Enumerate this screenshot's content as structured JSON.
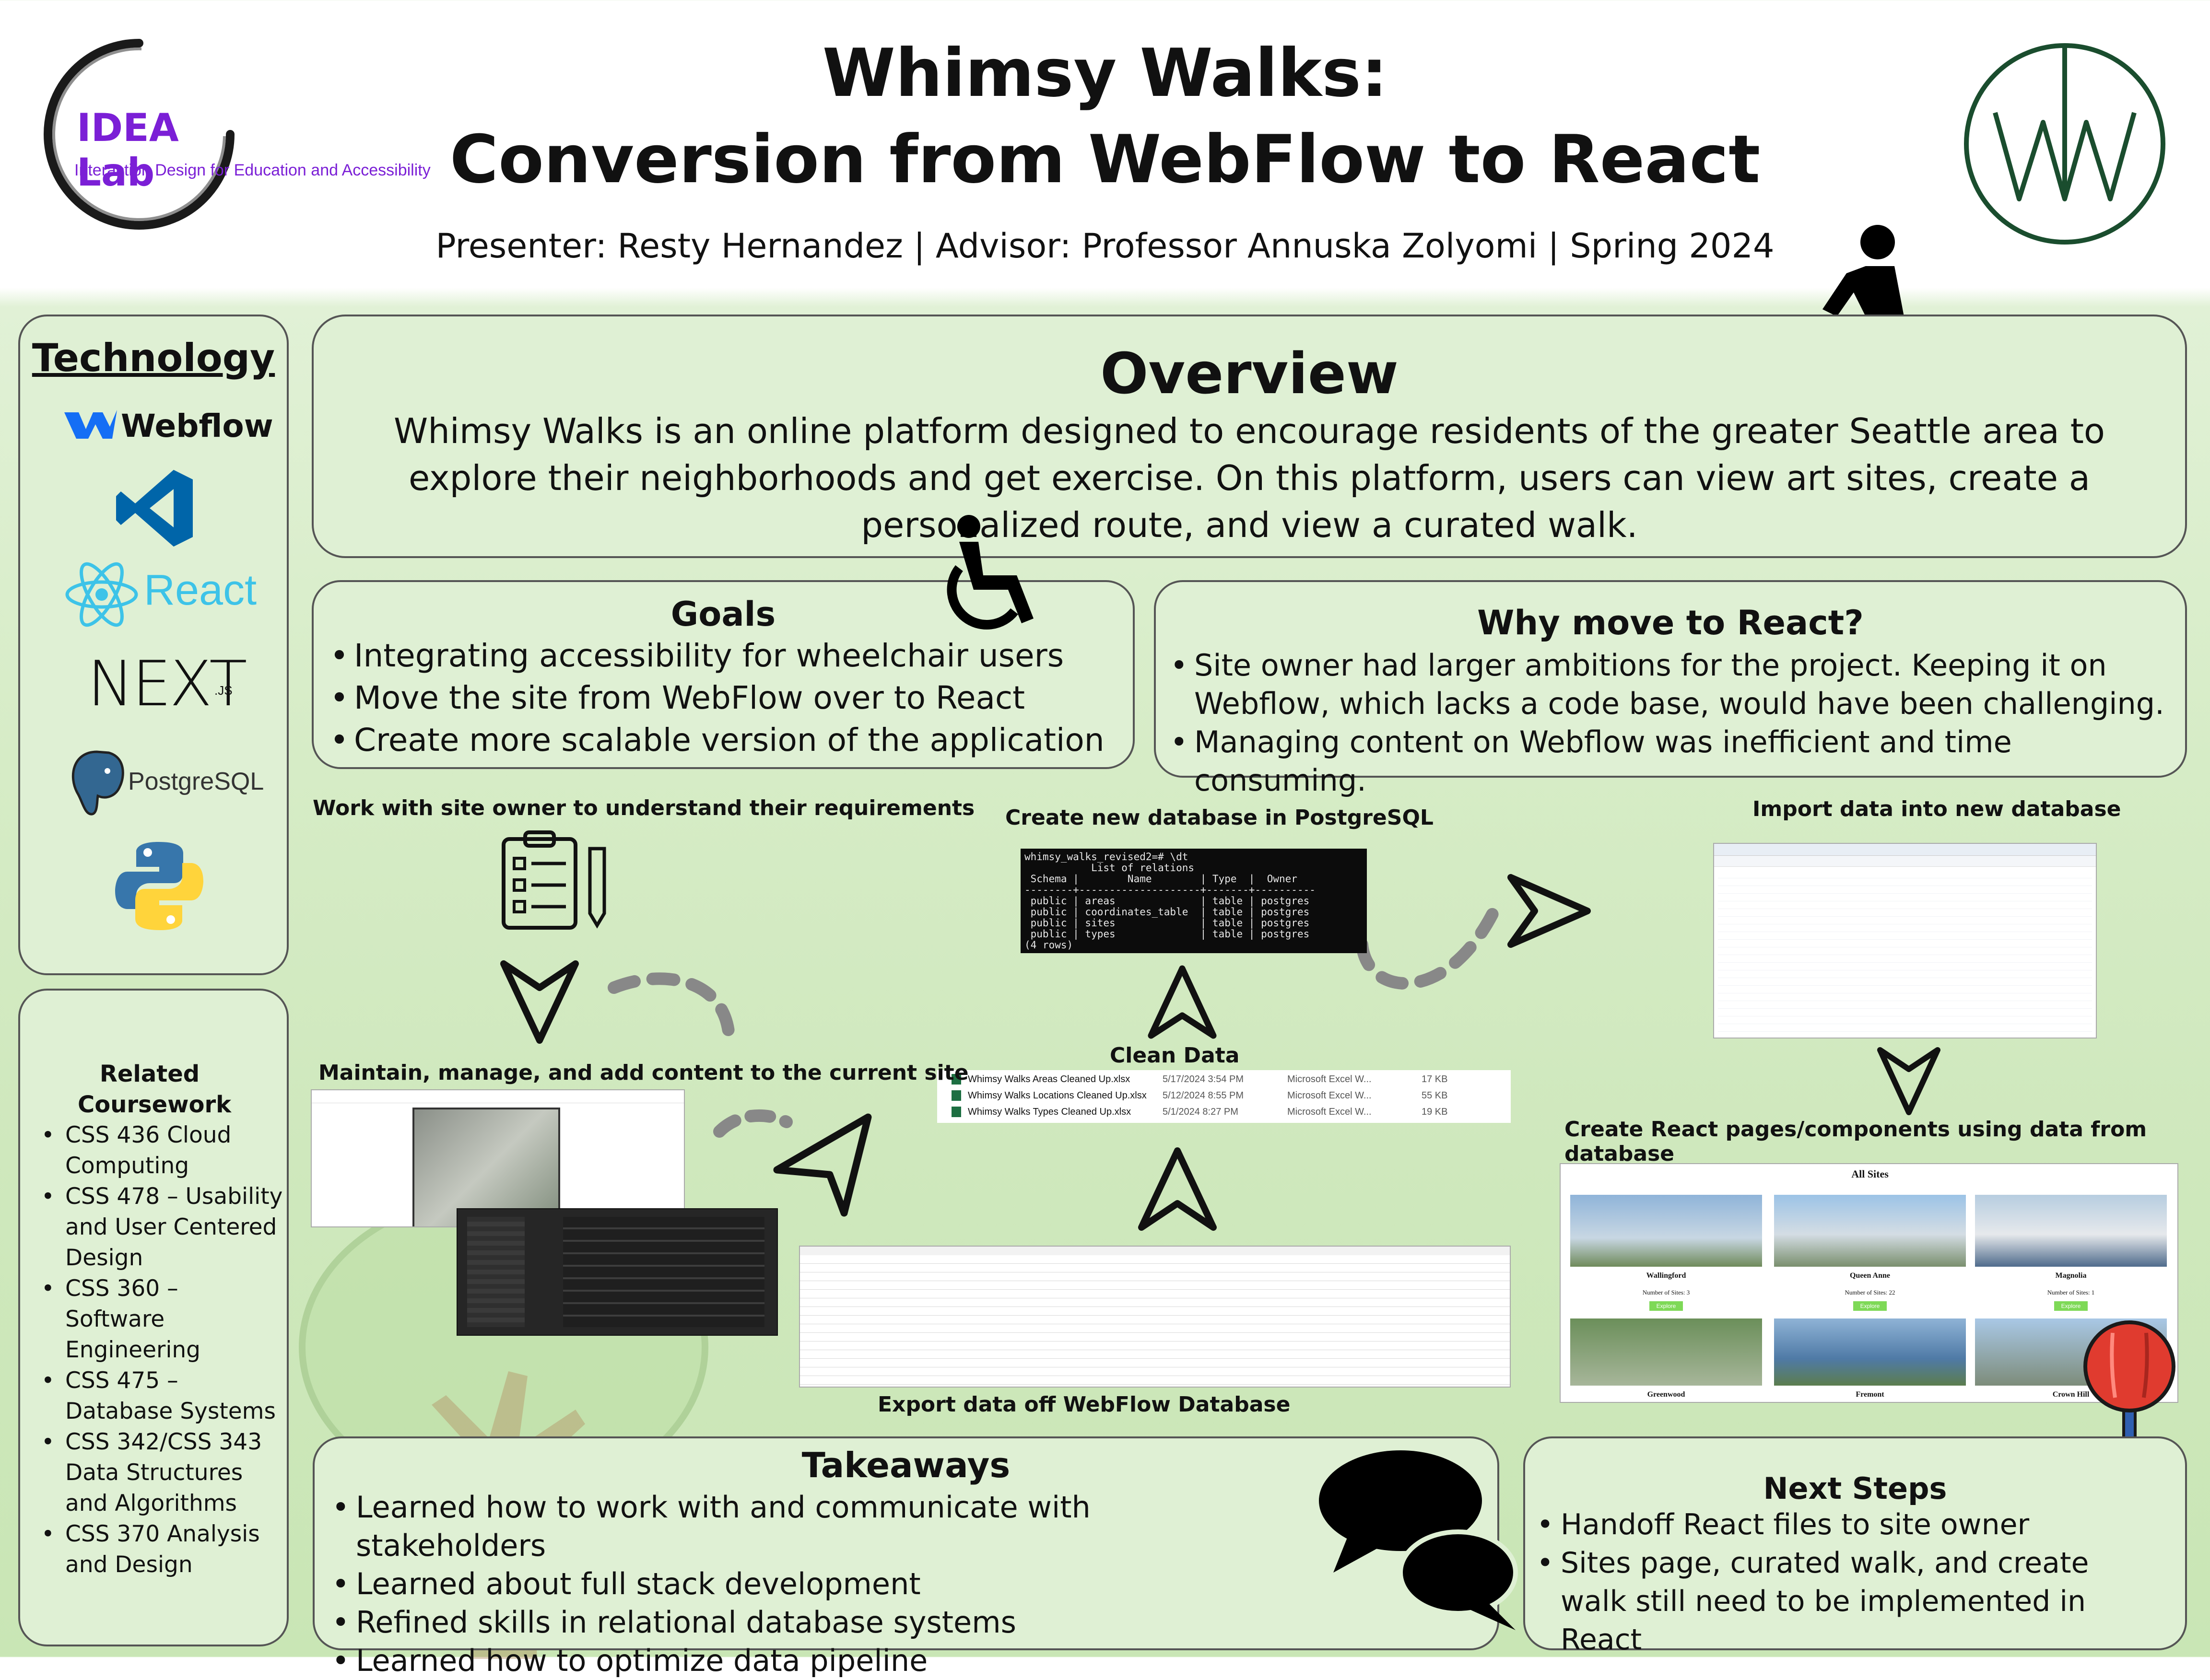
{
  "header": {
    "title_line1": "Whimsy Walks:",
    "title_line2": "Conversion from WebFlow to React",
    "byline": "Presenter: Resty Hernandez | Advisor: Professor Annuska Zolyomi | Spring 2024",
    "lab_logo": {
      "name": "IDEA Lab",
      "subtitle": "Interaction Design for Education and Accessibility"
    }
  },
  "technology": {
    "heading": "Technology",
    "items": [
      "Webflow",
      "React",
      "NEXT",
      ".JS",
      "PostgreSQL"
    ]
  },
  "coursework": {
    "heading": "Related Coursework",
    "items": [
      "CSS 436 Cloud Computing",
      "CSS 478 – Usability and User Centered Design",
      "CSS 360 – Software Engineering",
      "CSS 475 – Database Systems",
      "CSS 342/CSS 343 Data Structures and Algorithms",
      "CSS 370 Analysis and Design"
    ]
  },
  "overview": {
    "heading": "Overview",
    "body": "Whimsy Walks is an online platform designed to encourage residents of the greater Seattle area to explore their neighborhoods and get exercise. On this platform, users can view art sites, create a personalized route, and view a curated walk."
  },
  "goals": {
    "heading": "Goals",
    "items": [
      "Integrating accessibility for wheelchair users",
      "Move the site from WebFlow over to React",
      "Create more scalable version of the application"
    ]
  },
  "why": {
    "heading": "Why move to React?",
    "items": [
      "Site owner had larger ambitions for the project. Keeping it on Webflow, which lacks a code base, would have been challenging.",
      "Managing content on Webflow was inefficient and time consuming."
    ]
  },
  "process": {
    "requirements": "Work with site owner to understand their requirements",
    "maintain": "Maintain, manage, and add content to the current site",
    "export": "Export data off WebFlow Database",
    "clean": "Clean Data",
    "create_db": "Create new database in PostgreSQL",
    "import": "Import data into new database",
    "react_pages": "Create React pages/components using data from database"
  },
  "psql": {
    "lines": [
      "whimsy_walks_revised2=# \\dt",
      "           List of relations",
      " Schema |        Name        | Type  |  Owner",
      "--------+--------------------+-------+----------",
      " public | areas              | table | postgres",
      " public | coordinates_table  | table | postgres",
      " public | sites              | table | postgres",
      " public | types              | table | postgres",
      "(4 rows)"
    ]
  },
  "files": [
    {
      "name": "Whimsy Walks Areas Cleaned Up.xlsx",
      "date": "5/17/2024 3:54 PM",
      "type": "Microsoft Excel W...",
      "size": "17 KB"
    },
    {
      "name": "Whimsy Walks Locations Cleaned Up.xlsx",
      "date": "5/12/2024 8:55 PM",
      "type": "Microsoft Excel W...",
      "size": "55 KB"
    },
    {
      "name": "Whimsy Walks Types Cleaned Up.xlsx",
      "date": "5/1/2024 8:27 PM",
      "type": "Microsoft Excel W...",
      "size": "19 KB"
    }
  ],
  "react_preview": {
    "heading": "All Sites",
    "cards": [
      {
        "name": "Wallingford",
        "count": "Number of Sites: 3",
        "button": "Explore"
      },
      {
        "name": "Queen Anne",
        "count": "Number of Sites: 22",
        "button": "Explore"
      },
      {
        "name": "Magnolia",
        "count": "Number of Sites: 1",
        "button": "Explore"
      },
      {
        "name": "Greenwood"
      },
      {
        "name": "Fremont"
      },
      {
        "name": "Crown Hill"
      }
    ]
  },
  "takeaways": {
    "heading": "Takeaways",
    "items": [
      "Learned how to work with and communicate with stakeholders",
      "Learned about full stack development",
      "Refined skills in relational database systems",
      "Learned how to optimize data pipeline"
    ]
  },
  "next_steps": {
    "heading": "Next Steps",
    "items": [
      "Handoff React files to site owner",
      "Sites page, curated walk, and create walk still need to be implemented in React"
    ]
  },
  "colors": {
    "panel_bg": "#dff0d4",
    "panel_border": "#555555",
    "idea_purple": "#7b1fd6",
    "react_blue": "#3dc3e8",
    "vs_blue": "#0065a9",
    "ww_green": "#1a4d2e"
  }
}
